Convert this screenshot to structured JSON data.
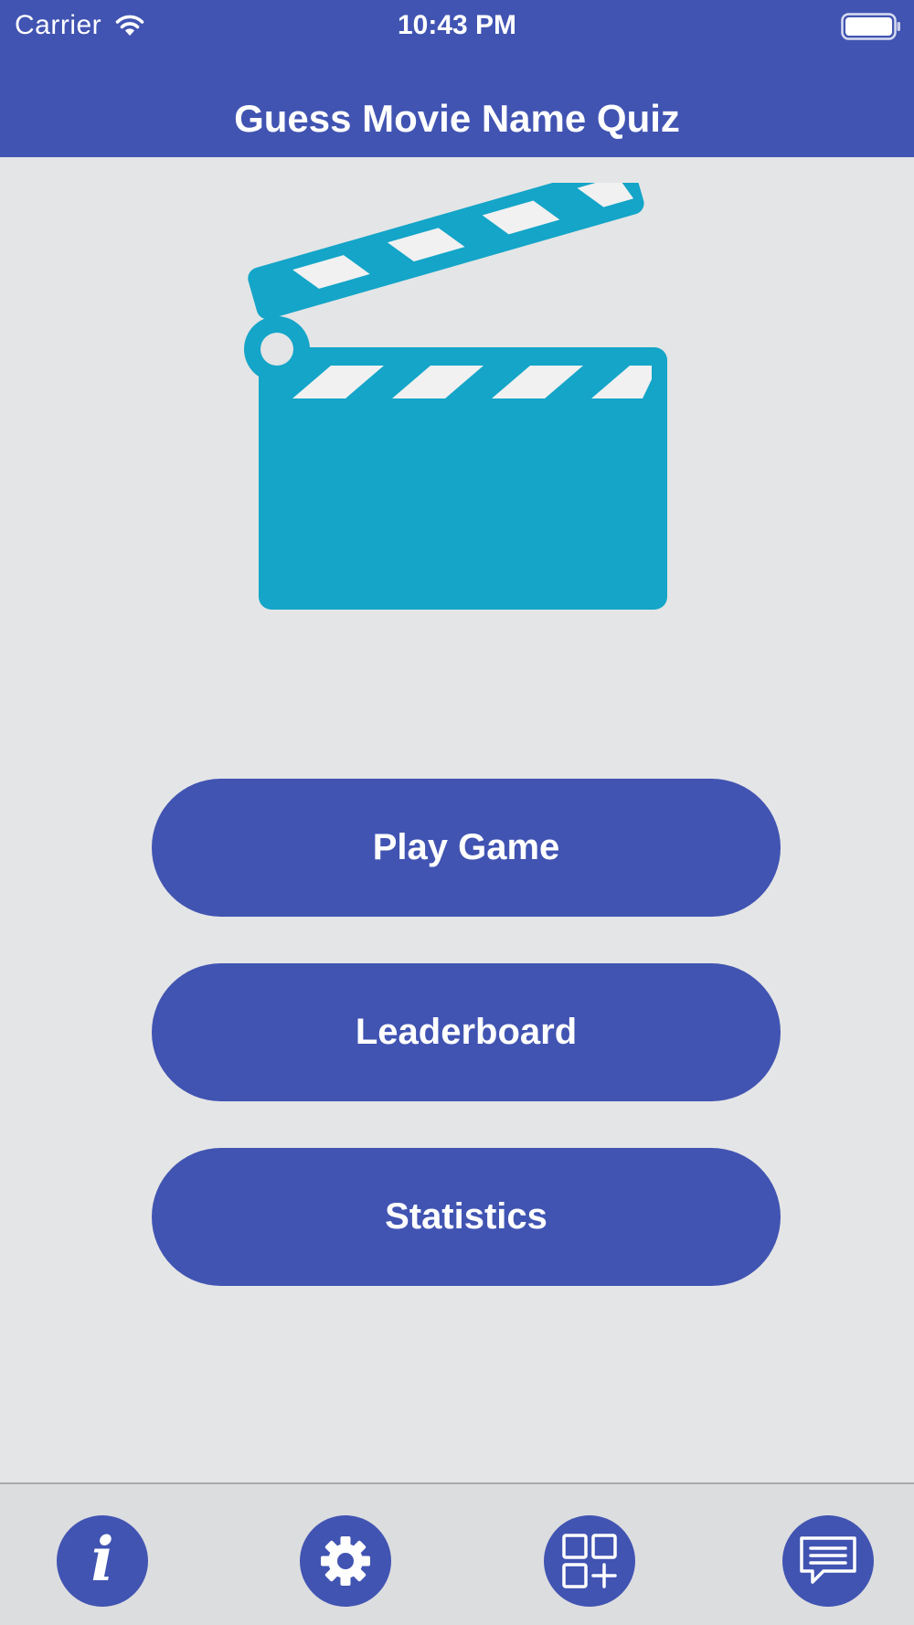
{
  "status_bar": {
    "carrier": "Carrier",
    "time": "10:43 PM",
    "icons": [
      "wifi-icon",
      "battery-icon"
    ]
  },
  "header": {
    "title": "Guess Movie Name Quiz"
  },
  "hero": {
    "icon": "clapperboard-icon",
    "color": "#14a5c8"
  },
  "menu": {
    "play_label": "Play Game",
    "leaderboard_label": "Leaderboard",
    "statistics_label": "Statistics"
  },
  "bottom_bar": {
    "buttons": [
      {
        "icon": "info-icon",
        "glyph": "i"
      },
      {
        "icon": "gear-icon"
      },
      {
        "icon": "apps-add-icon"
      },
      {
        "icon": "chat-icon"
      }
    ]
  },
  "colors": {
    "primary": "#4154b2",
    "background": "#e4e5e6",
    "accent": "#14a5c8",
    "bottom_bar": "#dcdddf"
  }
}
